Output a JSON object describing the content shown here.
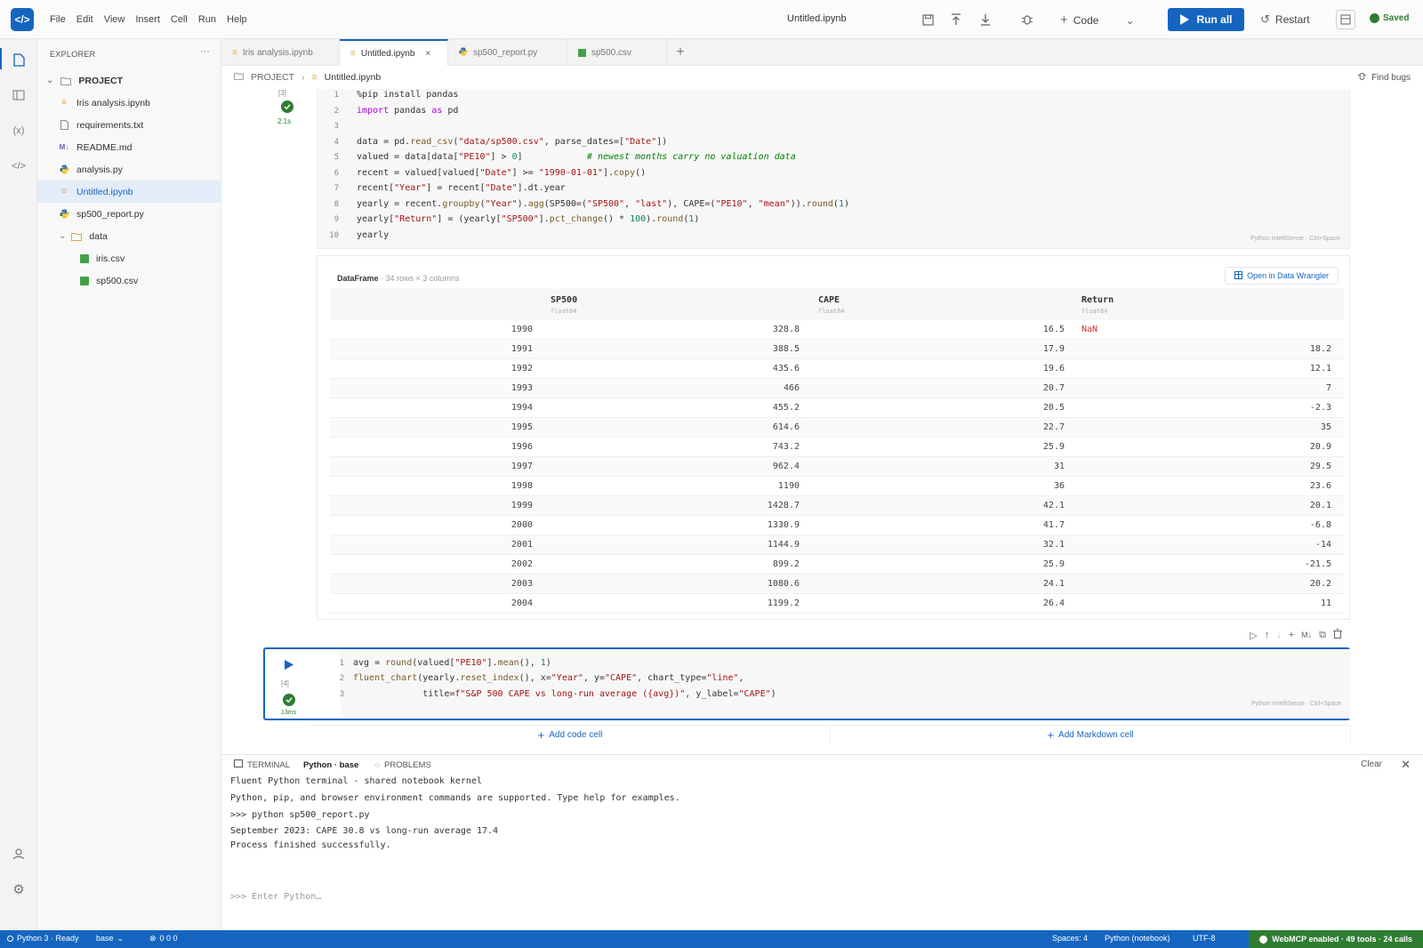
{
  "app": {
    "logo_glyph": "</>"
  },
  "menu": [
    "File",
    "Edit",
    "View",
    "Insert",
    "Cell",
    "Run",
    "Help"
  ],
  "notebook_title": "Untitled.ipynb",
  "toolbar": {
    "code_label": "Code",
    "run_all_label": "Run all",
    "restart_label": "Restart",
    "saved_label": "Saved"
  },
  "explorer": {
    "title": "EXPLORER",
    "project": "PROJECT",
    "files": [
      {
        "name": "Iris analysis.ipynb",
        "type": "notebook"
      },
      {
        "name": "requirements.txt",
        "type": "text"
      },
      {
        "name": "README.md",
        "type": "markdown"
      },
      {
        "name": "analysis.py",
        "type": "python"
      },
      {
        "name": "Untitled.ipynb",
        "type": "notebook",
        "selected": true
      },
      {
        "name": "sp500_report.py",
        "type": "python"
      }
    ],
    "folder": "data",
    "folder_files": [
      "iris.csv",
      "sp500.csv"
    ]
  },
  "tabs": [
    {
      "label": "Iris analysis.ipynb"
    },
    {
      "label": "Untitled.ipynb",
      "active": true
    },
    {
      "label": "sp500_report.py"
    },
    {
      "label": "sp500.csv"
    }
  ],
  "breadcrumb": {
    "root": "PROJECT",
    "file": "Untitled.ipynb",
    "find_bugs": "Find bugs"
  },
  "cell1": {
    "exec_label": "[3]",
    "time": "2.1s",
    "hint": "Python IntelliSense · Ctrl+Space",
    "line_numbers": [
      "1",
      "2",
      "3",
      "4",
      "5",
      "6",
      "7",
      "8",
      "9",
      "10"
    ]
  },
  "dataframe": {
    "title": "DataFrame",
    "meta": "· 34 rows × 3 columns",
    "open_label": "Open in Data Wrangler",
    "columns": [
      {
        "name": "SP500",
        "dtype": "float64"
      },
      {
        "name": "CAPE",
        "dtype": "float64"
      },
      {
        "name": "Return",
        "dtype": "float64"
      }
    ],
    "rows": [
      [
        "1990",
        "328.8",
        "16.5",
        "NaN"
      ],
      [
        "1991",
        "388.5",
        "17.9",
        "18.2"
      ],
      [
        "1992",
        "435.6",
        "19.6",
        "12.1"
      ],
      [
        "1993",
        "466",
        "20.7",
        "7"
      ],
      [
        "1994",
        "455.2",
        "20.5",
        "-2.3"
      ],
      [
        "1995",
        "614.6",
        "22.7",
        "35"
      ],
      [
        "1996",
        "743.2",
        "25.9",
        "20.9"
      ],
      [
        "1997",
        "962.4",
        "31",
        "29.5"
      ],
      [
        "1998",
        "1190",
        "36",
        "23.6"
      ],
      [
        "1999",
        "1428.7",
        "42.1",
        "20.1"
      ],
      [
        "2000",
        "1330.9",
        "41.7",
        "-6.8"
      ],
      [
        "2001",
        "1144.9",
        "32.1",
        "-14"
      ],
      [
        "2002",
        "899.2",
        "25.9",
        "-21.5"
      ],
      [
        "2003",
        "1080.6",
        "24.1",
        "20.2"
      ],
      [
        "2004",
        "1199.2",
        "26.4",
        "11"
      ]
    ]
  },
  "cell2": {
    "exec_label": "[4]",
    "time": "13ms",
    "hint": "Python IntelliSense · Ctrl+Space",
    "line_numbers": [
      "1",
      "2",
      "3"
    ]
  },
  "add_cells": {
    "code": "Add code cell",
    "markdown": "Add Markdown cell"
  },
  "terminal": {
    "tab_terminal": "TERMINAL",
    "tab_env": "Python · base",
    "tab_problems": "PROBLEMS",
    "clear_label": "Clear",
    "lines": [
      "Fluent Python terminal - shared notebook kernel",
      "Python, pip, and browser environment commands are supported. Type help for examples.",
      ">>> python sp500_report.py",
      "September 2023: CAPE 30.8 vs long-run average 17.4",
      "Process finished successfully."
    ],
    "input_placeholder": ">>> Enter Python…"
  },
  "status": {
    "kernel": "Python 3 · Ready",
    "env": "base",
    "problems": "0 0 0",
    "spaces": "Spaces: 4",
    "language": "Python (notebook)",
    "encoding": "UTF-8",
    "webmcp": "WebMCP enabled · 49 tools · 24 calls"
  },
  "colors": {
    "accent": "#1565c0",
    "success": "#2e7d32"
  }
}
